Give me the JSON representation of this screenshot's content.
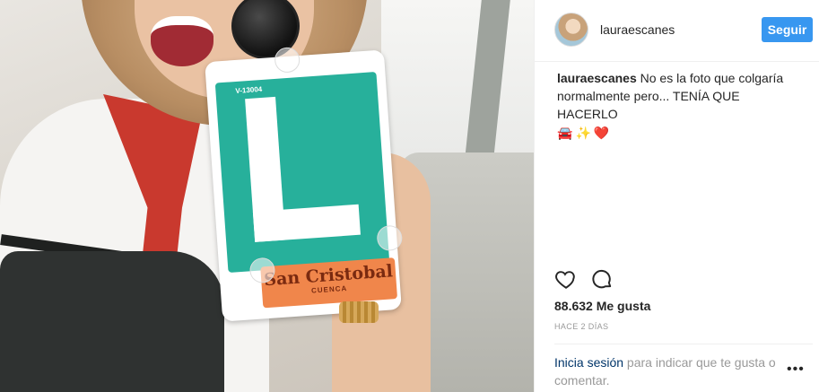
{
  "header": {
    "username": "lauraescanes",
    "follow_label": "Seguir"
  },
  "caption": {
    "username": "lauraescanes",
    "text": "No es la foto que colgaría normalmente pero... TENÍA QUE HACERLO",
    "emojis": [
      "🚘",
      "✨",
      "❤️"
    ]
  },
  "photo": {
    "sign_code": "V-13004",
    "sign_brand": "San Cristobal",
    "sign_city": "CUENCA"
  },
  "actions": {
    "like_icon": "heart-icon",
    "comment_icon": "comment-icon"
  },
  "likes_text": "88.632 Me gusta",
  "time_ago": "HACE 2 DÍAS",
  "login_prompt": {
    "link": "Inicia sesión",
    "text": " para indicar que te gusta o comentar."
  },
  "more_label": "•••",
  "colors": {
    "accent": "#3897f0",
    "link": "#003569",
    "heart": "#ed4956"
  }
}
